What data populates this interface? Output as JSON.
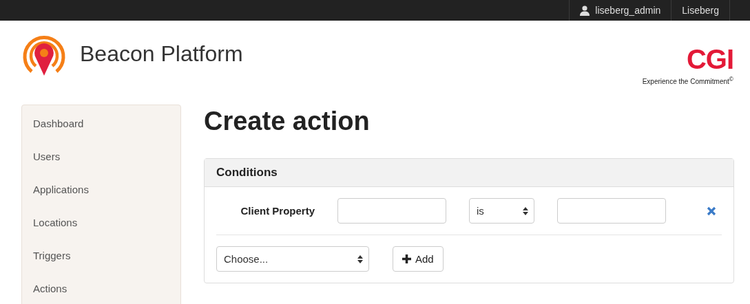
{
  "top_bar": {
    "user": "liseberg_admin",
    "organization": "Liseberg"
  },
  "header": {
    "title": "Beacon Platform",
    "brand": "CGI",
    "tagline": "Experience the Commitment$^{©}$"
  },
  "sidebar": {
    "items": [
      {
        "label": "Dashboard"
      },
      {
        "label": "Users"
      },
      {
        "label": "Applications"
      },
      {
        "label": "Locations"
      },
      {
        "label": "Triggers"
      },
      {
        "label": "Actions"
      }
    ]
  },
  "page": {
    "heading": "Create action"
  },
  "conditions": {
    "title": "Conditions",
    "rows": [
      {
        "label": "Client Property",
        "operator": "is"
      }
    ],
    "choose": "Choose...",
    "add_button": "Add"
  }
}
